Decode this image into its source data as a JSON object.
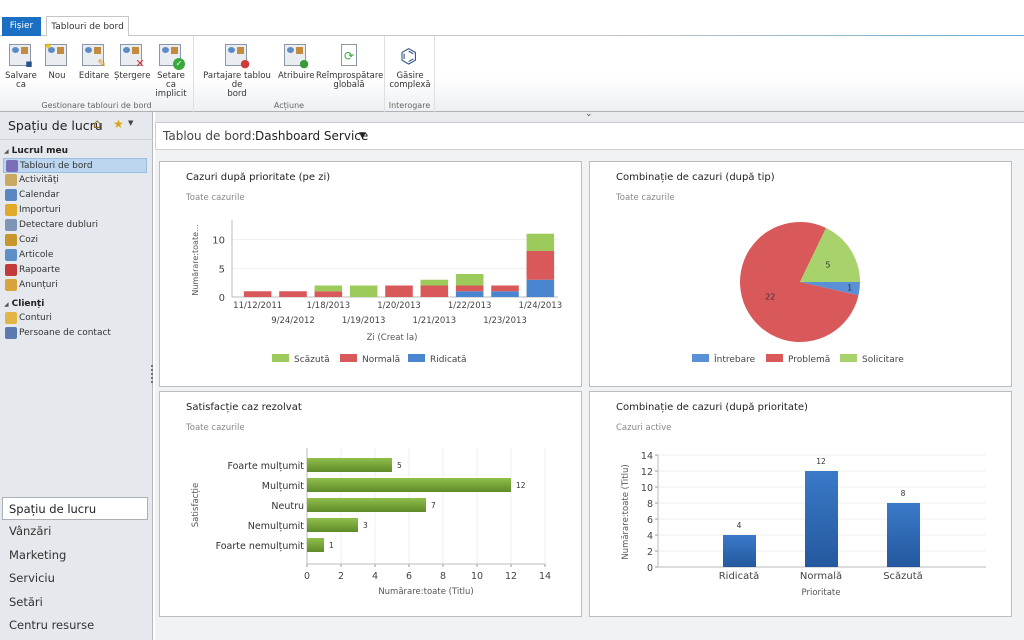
{
  "tabs": {
    "file": "Fișier",
    "dashboards": "Tablouri de bord"
  },
  "ribbon": {
    "groups": [
      {
        "label": "Gestionare tablouri de bord",
        "buttons": [
          {
            "label1": "Salvare",
            "label2": "ca",
            "icon": "save-as-icon"
          },
          {
            "label1": "Nou",
            "label2": "",
            "icon": "new-icon"
          },
          {
            "label1": "Editare",
            "label2": "",
            "icon": "edit-icon"
          },
          {
            "label1": "Ștergere",
            "label2": "",
            "icon": "delete-icon"
          },
          {
            "label1": "Setare ca",
            "label2": "implicit",
            "icon": "set-default-icon"
          }
        ]
      },
      {
        "label": "Acțiune",
        "buttons": [
          {
            "label1": "Partajare tablou de",
            "label2": "bord",
            "icon": "share-icon"
          },
          {
            "label1": "Atribuire",
            "label2": "",
            "icon": "assign-icon"
          },
          {
            "label1": "Reîmprospătare",
            "label2": "globală",
            "icon": "refresh-icon"
          }
        ]
      },
      {
        "label": "Interogare",
        "buttons": [
          {
            "label1": "Găsire",
            "label2": "complexă",
            "icon": "advanced-find-icon"
          }
        ]
      }
    ]
  },
  "nav": {
    "workspace_title": "Spațiu de lucru",
    "groups": [
      {
        "label": "Lucrul meu",
        "items": [
          {
            "label": "Tablouri de bord",
            "selected": true,
            "color": "#7a6fb8"
          },
          {
            "label": "Activități",
            "color": "#c9a860"
          },
          {
            "label": "Calendar",
            "color": "#5a86c4"
          },
          {
            "label": "Importuri",
            "color": "#e0a92a"
          },
          {
            "label": "Detectare dubluri",
            "color": "#7f95b6"
          },
          {
            "label": "Cozi",
            "color": "#c9962c"
          },
          {
            "label": "Articole",
            "color": "#5a8fc7"
          },
          {
            "label": "Rapoarte",
            "color": "#c23a3a"
          },
          {
            "label": "Anunțuri",
            "color": "#d8a33b"
          }
        ]
      },
      {
        "label": "Clienți",
        "items": [
          {
            "label": "Conturi",
            "color": "#e2b544"
          },
          {
            "label": "Persoane de contact",
            "color": "#5a7ab0"
          }
        ]
      }
    ],
    "areas": [
      {
        "label": "Spațiu de lucru",
        "selected": true
      },
      {
        "label": "Vânzări"
      },
      {
        "label": "Marketing"
      },
      {
        "label": "Serviciu"
      },
      {
        "label": "Setări"
      },
      {
        "label": "Centru resurse"
      }
    ]
  },
  "dashboard": {
    "label": "Tablou de bord:",
    "name": "Dashboard Service"
  },
  "panels": [
    {
      "title": "Cazuri după prioritate (pe zi)",
      "subtitle": "Toate cazurile"
    },
    {
      "title": "Combinație de cazuri (după tip)",
      "subtitle": "Toate cazurile"
    },
    {
      "title": "Satisfacție caz rezolvat",
      "subtitle": "Toate cazurile"
    },
    {
      "title": "Combinație de cazuri (după prioritate)",
      "subtitle": "Cazuri active"
    }
  ],
  "colors": {
    "green": "#9ccb5c",
    "red": "#d9585a",
    "blue": "#4a86cf",
    "darkgreen": "#6f9a35",
    "darkblue": "#2d68b4"
  },
  "chart_data": [
    {
      "type": "bar",
      "stacked": true,
      "title": "Cazuri după prioritate (pe zi)",
      "subtitle": "Toate cazurile",
      "categories": [
        "11/12/2011",
        "9/24/2012",
        "1/18/2013",
        "1/19/2013",
        "1/20/2013",
        "1/21/2013",
        "1/22/2013",
        "1/23/2013",
        "1/24/2013"
      ],
      "series": [
        {
          "name": "Ridicată",
          "color": "#4a86cf",
          "values": [
            0,
            0,
            0,
            0,
            0,
            0,
            1,
            1,
            3
          ]
        },
        {
          "name": "Normală",
          "color": "#d9585a",
          "values": [
            1,
            1,
            1,
            0,
            2,
            2,
            1,
            1,
            5
          ]
        },
        {
          "name": "Scăzută",
          "color": "#9ccb5c",
          "values": [
            0,
            0,
            1,
            2,
            0,
            1,
            2,
            0,
            3
          ]
        }
      ],
      "legend_order": [
        "Scăzută",
        "Normală",
        "Ridicată"
      ],
      "xlabel": "Zi (Creat la)",
      "ylabel": "Numărare:toate...",
      "ylim": [
        0,
        12
      ],
      "yticks": [
        0,
        5,
        10
      ],
      "legend": "bottom"
    },
    {
      "type": "pie",
      "title": "Combinație de cazuri (după tip)",
      "subtitle": "Toate cazurile",
      "slices": [
        {
          "label": "Întrebare",
          "value": 1,
          "color": "#5b8fd6"
        },
        {
          "label": "Problemă",
          "value": 22,
          "color": "#d9585a"
        },
        {
          "label": "Solicitare",
          "value": 5,
          "color": "#a8d26b"
        }
      ],
      "legend": "bottom"
    },
    {
      "type": "bar",
      "orientation": "horizontal",
      "title": "Satisfacție caz rezolvat",
      "subtitle": "Toate cazurile",
      "categories": [
        "Foarte mulțumit",
        "Mulțumit",
        "Neutru",
        "Nemulțumit",
        "Foarte nemulțumit"
      ],
      "values": [
        5,
        12,
        7,
        3,
        1
      ],
      "xlabel": "Numărare:toate (Titlu)",
      "ylabel": "Satisfacție",
      "xlim": [
        0,
        14
      ],
      "xticks": [
        0,
        2,
        4,
        6,
        8,
        10,
        12,
        14
      ]
    },
    {
      "type": "bar",
      "title": "Combinație de cazuri (după prioritate)",
      "subtitle": "Cazuri active",
      "categories": [
        "Ridicată",
        "Normală",
        "Scăzută"
      ],
      "values": [
        4,
        12,
        8
      ],
      "xlabel": "Prioritate",
      "ylabel": "Numărare:toate (Titlu)",
      "ylim": [
        0,
        14
      ],
      "yticks": [
        0,
        2,
        4,
        6,
        8,
        10,
        12,
        14
      ]
    }
  ]
}
